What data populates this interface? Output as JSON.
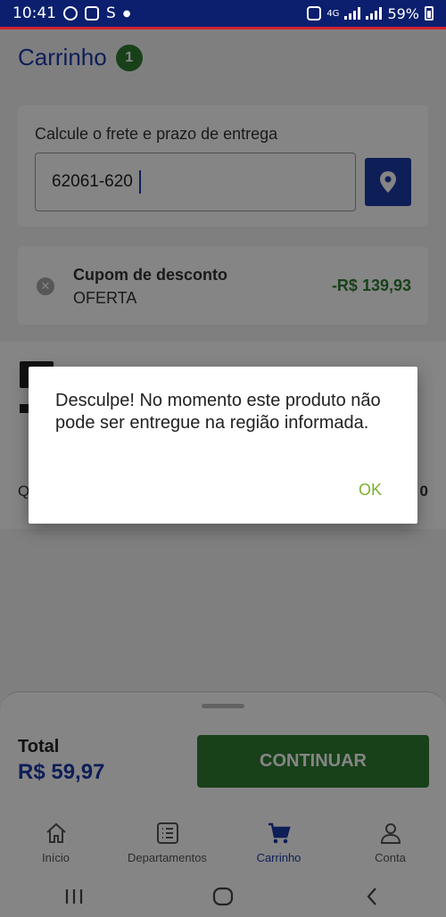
{
  "status_bar": {
    "time": "10:41",
    "network": "4G",
    "battery": "59%"
  },
  "header": {
    "title": "Carrinho",
    "item_count": "1"
  },
  "shipping": {
    "label": "Calcule o frete e prazo de entrega",
    "cep_value": "62061-620"
  },
  "coupon": {
    "title": "Cupom de desconto",
    "code": "OFERTA",
    "discount": "-R$ 139,93"
  },
  "product": {
    "quantity_label": "Q",
    "price_fragment": "0"
  },
  "summary": {
    "total_label": "Total",
    "total_value": "R$ 59,97",
    "continue_label": "CONTINUAR"
  },
  "tabs": [
    {
      "label": "Início",
      "icon": "home-icon",
      "active": false
    },
    {
      "label": "Departamentos",
      "icon": "list-icon",
      "active": false
    },
    {
      "label": "Carrinho",
      "icon": "cart-icon",
      "active": true
    },
    {
      "label": "Conta",
      "icon": "person-icon",
      "active": false
    }
  ],
  "dialog": {
    "message": "Desculpe! No momento este produto não pode ser entregue na região informada.",
    "ok_label": "OK"
  },
  "colors": {
    "brand_blue": "#1b3aa8",
    "status_bar": "#0b1f6e",
    "success_green": "#2e7d32",
    "ok_green": "#7ab02f"
  }
}
